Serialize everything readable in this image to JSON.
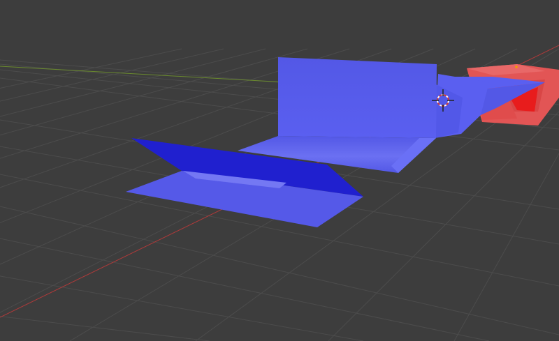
{
  "viewport": {
    "background": "#3d3d3d",
    "grid_color": "#4a4a4a",
    "x_axis_color": "#b03a3a",
    "y_axis_color": "#6a8a2e"
  },
  "scene": {
    "blue_material": "#5559e8",
    "blue_dark": "#2020cf",
    "red_material": "#e85b5b",
    "cursor_icon": "3d-cursor-icon"
  }
}
